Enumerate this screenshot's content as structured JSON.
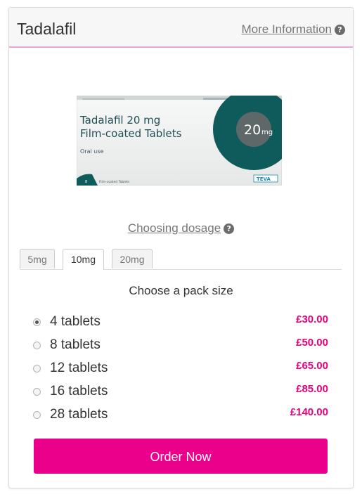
{
  "header": {
    "title": "Tadalafil",
    "more_info_label": "More Information",
    "help_icon": "question-circle-icon"
  },
  "product_image": {
    "box_title_line1": "Tadalafil 20 mg",
    "box_title_line2": "Film-coated Tablets",
    "box_route": "Oral use",
    "box_dose": "20",
    "box_dose_unit": "mg",
    "box_count": "8",
    "box_count_text": "Film-coated Tablets",
    "box_brand": "TEVA"
  },
  "dosage": {
    "label": "Choosing dosage",
    "help_icon": "question-circle-icon"
  },
  "tabs": [
    {
      "label": "5mg",
      "active": false
    },
    {
      "label": "10mg",
      "active": true
    },
    {
      "label": "20mg",
      "active": false
    }
  ],
  "pack": {
    "heading": "Choose a pack size",
    "selected_index": 0,
    "options": [
      {
        "label": "4 tablets",
        "price": "£30.00"
      },
      {
        "label": "8 tablets",
        "price": "£50.00"
      },
      {
        "label": "12 tablets",
        "price": "£65.00"
      },
      {
        "label": "16 tablets",
        "price": "£85.00"
      },
      {
        "label": "28 tablets",
        "price": "£140.00"
      }
    ]
  },
  "order_button": {
    "label": "Order Now"
  },
  "colors": {
    "accent": "#eb008b",
    "price": "#e5007e",
    "header_border": "#e9a6d3",
    "box_teal": "#0f5a5a"
  }
}
